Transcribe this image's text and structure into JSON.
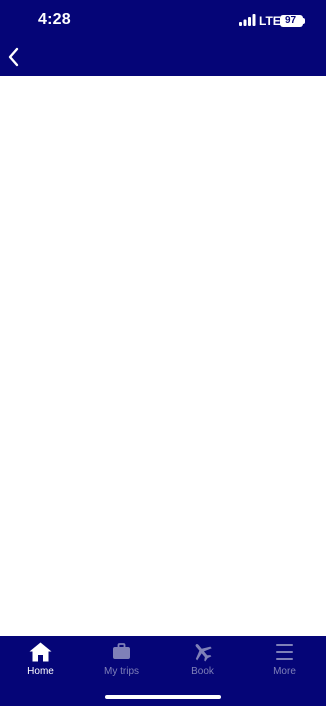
{
  "status_bar": {
    "time": "4:28",
    "network": "LTE",
    "battery": "97"
  },
  "nav": {
    "back_icon": "chevron-left-icon"
  },
  "tab_bar": {
    "tabs": [
      {
        "label": "Home",
        "icon": "home-icon",
        "active": true
      },
      {
        "label": "My trips",
        "icon": "briefcase-icon",
        "active": false
      },
      {
        "label": "Book",
        "icon": "airplane-icon",
        "active": false
      },
      {
        "label": "More",
        "icon": "menu-icon",
        "active": false
      }
    ]
  },
  "colors": {
    "header_background": "#050577",
    "tab_active": "#ffffff",
    "tab_inactive": "#7f80b8",
    "content_background": "#ffffff"
  }
}
